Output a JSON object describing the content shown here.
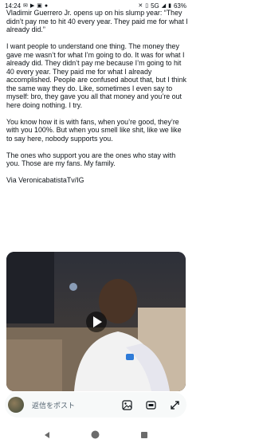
{
  "status_bar": {
    "time": "14:24",
    "network": "5G",
    "battery": "63%"
  },
  "post": {
    "paragraphs": [
      "Vladimir Guerrero Jr. opens up on his slump year: “They didn’t pay me to hit 40 every year. They paid me for what I already did.”",
      "I want people to understand one thing. The money they gave me wasn’t for what I’m going to do. It was for what I already did. They didn’t pay me because I’m going to hit 40 every year. They paid me for what I already accomplished. People are confused about that, but I think the same way they do. Like, sometimes I even say to myself: bro, they gave you all that money and you’re out here doing nothing. I try.",
      "You know how it is with fans, when you’re good, they’re with you 100%. But when you smell like shit, like we like to say here, nobody supports you.",
      "The ones who support you are the ones who stay with you. Those are my fans. My family.",
      "Via VeronicabatistaTv/IG"
    ]
  },
  "reply_bar": {
    "placeholder": "返信をポスト"
  },
  "icons": {
    "status_left": [
      "mail-icon",
      "video-call-icon",
      "image-icon",
      "app-icon"
    ],
    "status_right": [
      "mute-icon",
      "vibrate-icon",
      "signal-icon",
      "battery-icon"
    ],
    "reply_bar": [
      "image-icon",
      "gif-icon",
      "expand-icon"
    ],
    "nav": [
      "back-icon",
      "home-icon",
      "recents-icon"
    ]
  }
}
